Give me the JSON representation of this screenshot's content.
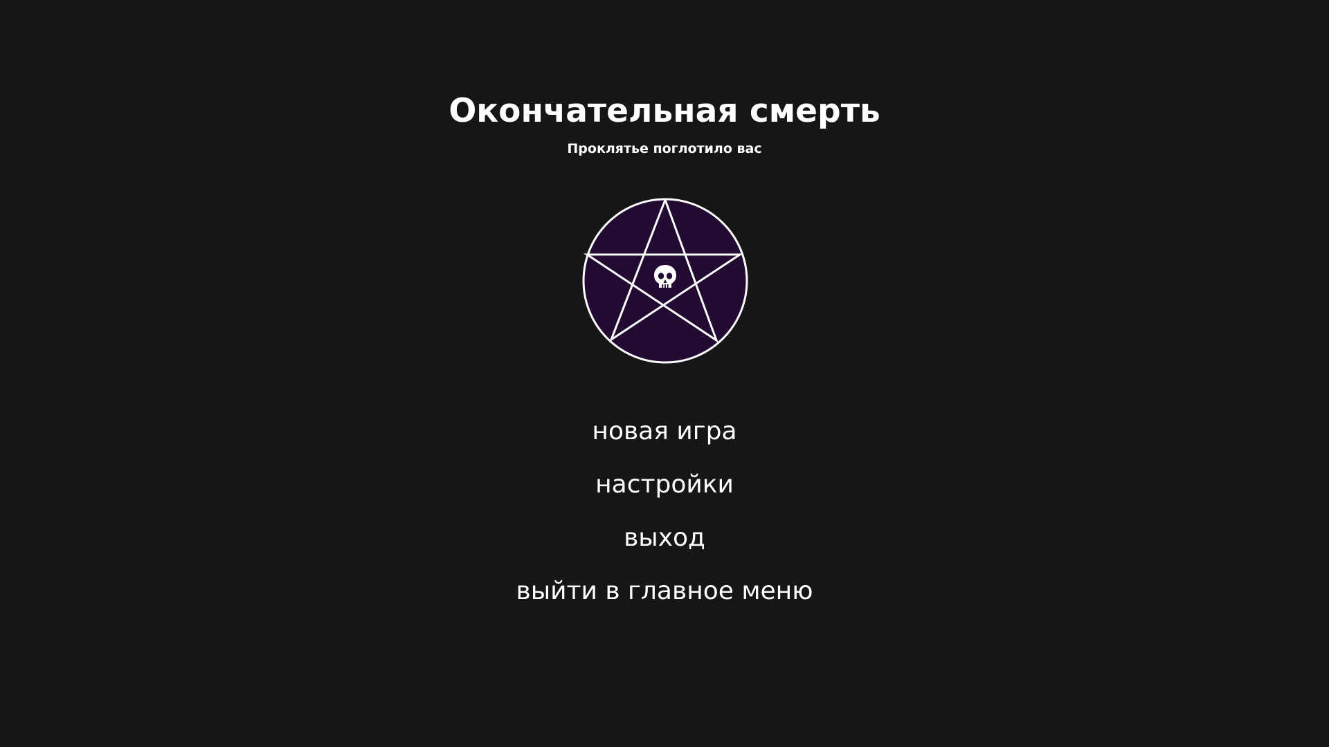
{
  "screen": {
    "title": "Окончательная смерть",
    "subtitle": "Проклятье поглотило вас"
  },
  "emblem": {
    "icon": "pentagram-icon",
    "center_icon": "skull-icon",
    "fill_color": "#230a33",
    "stroke_color": "#ffffff"
  },
  "menu": {
    "items": [
      {
        "label": "новая игра"
      },
      {
        "label": "настройки"
      },
      {
        "label": "выход"
      },
      {
        "label": "выйти в главное меню"
      }
    ]
  },
  "colors": {
    "background": "#161616",
    "text": "#ffffff",
    "accent": "#230a33"
  }
}
